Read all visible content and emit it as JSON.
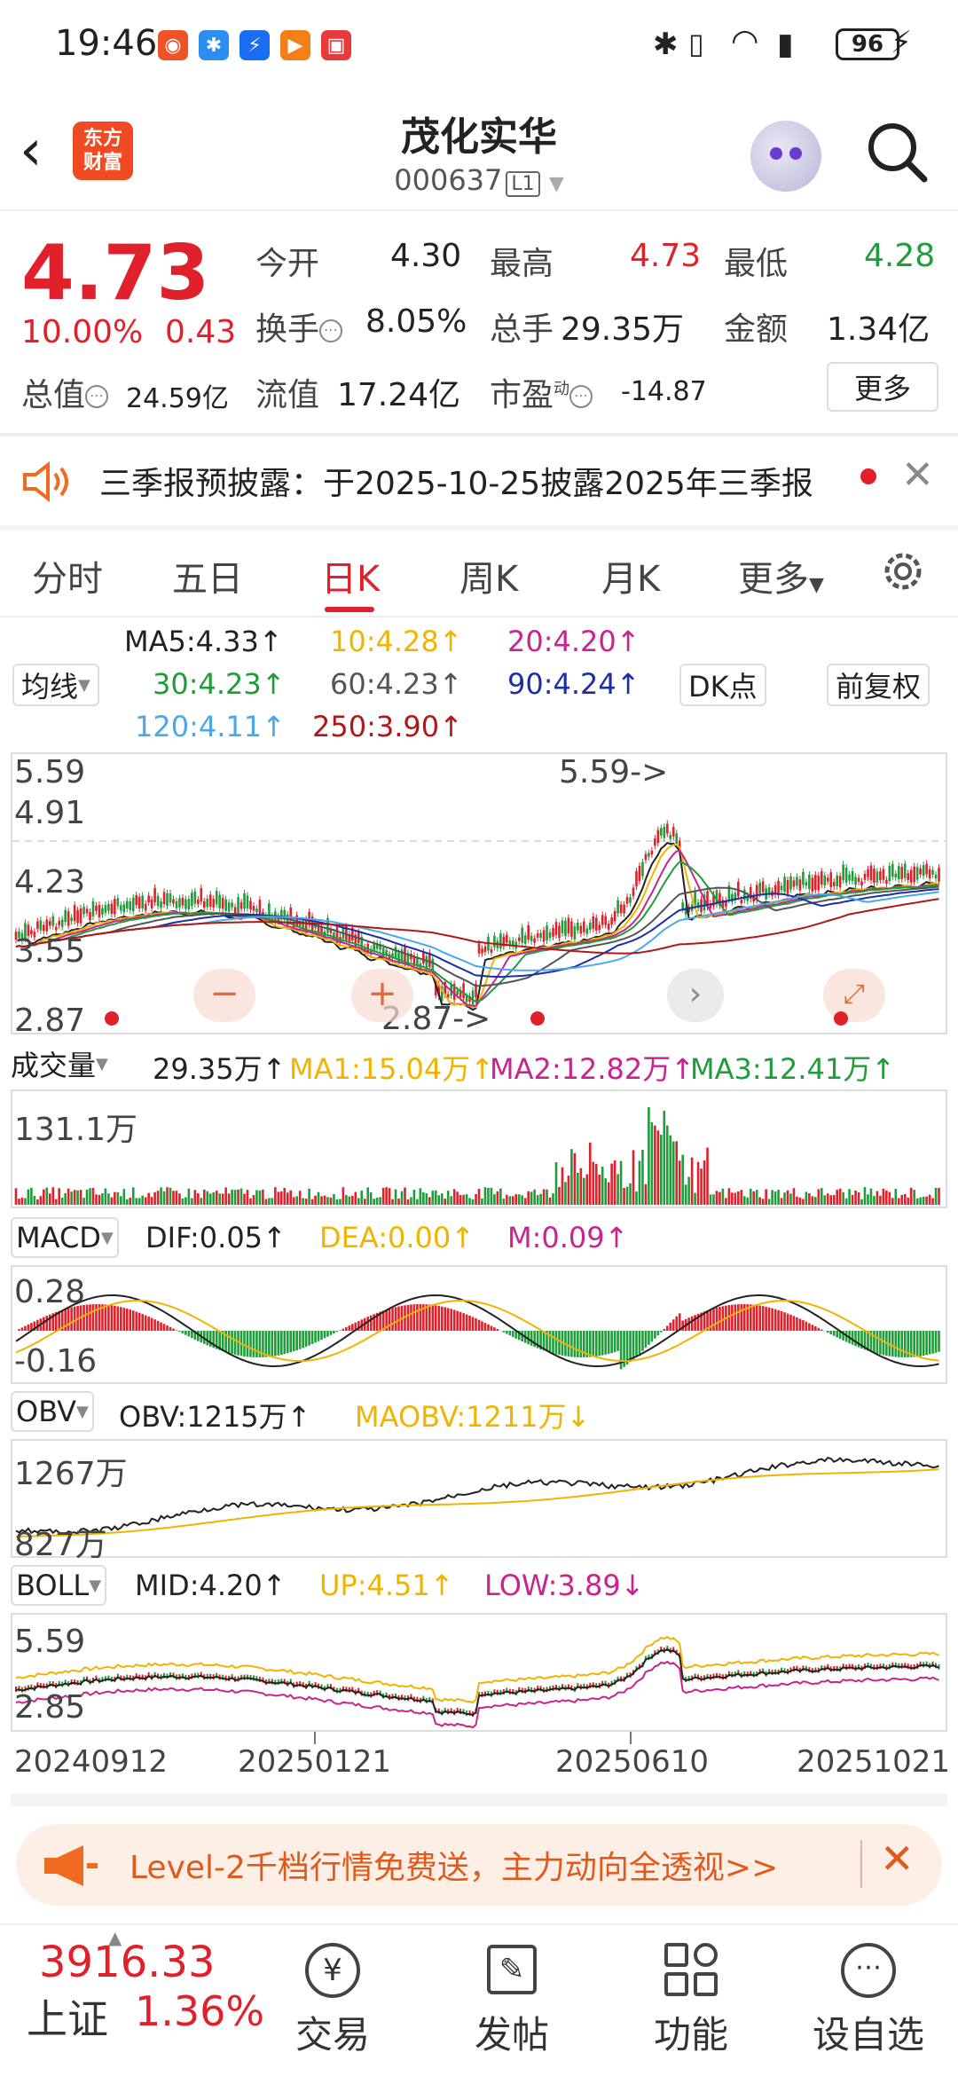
{
  "status_bar": {
    "time": "19:46",
    "battery": "96",
    "app_icons": [
      {
        "name": "app-icon-1",
        "color": "#f0522a",
        "glyph": "◉"
      },
      {
        "name": "bluetooth-app-icon",
        "color": "#2b8ef0",
        "glyph": "✱"
      },
      {
        "name": "app-icon-3",
        "color": "#1a6cf0",
        "glyph": "⚡"
      },
      {
        "name": "app-icon-4",
        "color": "#f57f17",
        "glyph": "▶"
      },
      {
        "name": "app-icon-5",
        "color": "#e83a3a",
        "glyph": "▣"
      }
    ]
  },
  "header": {
    "logo_text_line1": "东方",
    "logo_text_line2": "财富",
    "stock_name": "茂化实华",
    "stock_code": "000637",
    "market_badge": "L1"
  },
  "quote": {
    "price": "4.73",
    "change_pct": "10.00%",
    "change_abs": "0.43",
    "open_label": "今开",
    "open": "4.30",
    "high_label": "最高",
    "high": "4.73",
    "low_label": "最低",
    "low": "4.28",
    "turnover_label": "换手",
    "turnover": "8.05%",
    "volume_label": "总手",
    "volume": "29.35万",
    "amount_label": "金额",
    "amount": "1.34亿",
    "mktcap_label": "总值",
    "mktcap": "24.59亿",
    "float_label": "流值",
    "float_cap": "17.24亿",
    "pe_label": "市盈",
    "pe_sup": "动",
    "pe": "-14.87",
    "more_button": "更多"
  },
  "notice": {
    "text": "三季报预披露：于2025-10-25披露2025年三季报"
  },
  "tabs": [
    {
      "label": "分时",
      "active": false
    },
    {
      "label": "五日",
      "active": false
    },
    {
      "label": "日K",
      "active": true
    },
    {
      "label": "周K",
      "active": false
    },
    {
      "label": "月K",
      "active": false
    },
    {
      "label": "更多",
      "active": false
    }
  ],
  "ma_legend": {
    "selector": "均线",
    "ma5": "MA5:4.33↑",
    "ma10": "10:4.28↑",
    "ma20": "20:4.20↑",
    "ma30": "30:4.23↑",
    "ma60": "60:4.23↑",
    "ma90": "90:4.24↑",
    "ma120": "120:4.11↑",
    "ma250": "250:3.90↑",
    "dk_button": "DK点",
    "fq_button": "前复权",
    "colors": {
      "ma5": "#222222",
      "ma10": "#f0b400",
      "ma20": "#c8238f",
      "ma30": "#1f9d3a",
      "ma60": "#555555",
      "ma90": "#1b2ea8",
      "ma120": "#4aa8e8",
      "ma250": "#b01818"
    }
  },
  "chart_data": [
    {
      "type": "candlestick",
      "title": "日K",
      "y_ticks": [
        "5.59",
        "4.91",
        "4.23",
        "3.55",
        "2.87"
      ],
      "ylim": [
        2.87,
        5.59
      ],
      "annotations": [
        "5.59->",
        "2.87->"
      ],
      "x_ticks": [
        "20240912",
        "20250121",
        "20250610",
        "20251021"
      ]
    },
    {
      "type": "bar",
      "title": "成交量",
      "legend": [
        "29.35万↑",
        "MA1:15.04万↑",
        "MA2:12.82万↑",
        "MA3:12.41万↑"
      ],
      "y_ticks": [
        "131.1万"
      ]
    },
    {
      "type": "bar",
      "title": "MACD",
      "legend": [
        "DIF:0.05↑",
        "DEA:0.00↑",
        "M:0.09↑"
      ],
      "y_ticks": [
        "0.28",
        "-0.16"
      ]
    },
    {
      "type": "line",
      "title": "OBV",
      "legend": [
        "OBV:1215万↑",
        "MAOBV:1211万↓"
      ],
      "y_ticks": [
        "1267万",
        "827万"
      ]
    },
    {
      "type": "line",
      "title": "BOLL",
      "legend": [
        "MID:4.20↑",
        "UP:4.51↑",
        "LOW:3.89↓"
      ],
      "y_ticks": [
        "5.59",
        "2.85"
      ]
    }
  ],
  "banner": {
    "text": "Level-2千档行情免费送，主力动向全透视>>"
  },
  "bottom_nav": {
    "index_value": "3916.33",
    "index_name": "上证",
    "index_change": "1.36%",
    "items": [
      "交易",
      "发帖",
      "功能",
      "设自选"
    ]
  }
}
